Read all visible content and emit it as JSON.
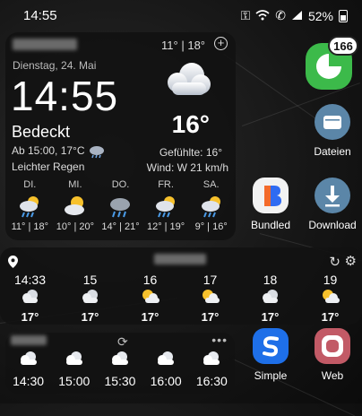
{
  "status_bar": {
    "time": "14:55",
    "battery": "52%"
  },
  "main_widget": {
    "hi_lo": "11° | 18°",
    "add_symbol": "+",
    "date": "Dienstag, 24. Mai",
    "time": "14:55",
    "condition": "Bedeckt",
    "forecast_note": "Ab 15:00, 17°C",
    "forecast_condition": "Leichter Regen",
    "temperature": "16°",
    "feels_like": "Gefühlte: 16°",
    "wind": "Wind: W 21 km/h",
    "days": [
      {
        "name": "DI.",
        "temps": "11° | 18°",
        "icon": "rain-cloud-sun"
      },
      {
        "name": "MI.",
        "temps": "10° | 20°",
        "icon": "partly-cloudy"
      },
      {
        "name": "DO.",
        "temps": "14° | 21°",
        "icon": "rain-cloud-grey"
      },
      {
        "name": "FR.",
        "temps": "12° | 19°",
        "icon": "rain-cloud-sun"
      },
      {
        "name": "SA.",
        "temps": "9° | 16°",
        "icon": "rain-cloud-sun"
      }
    ]
  },
  "hourly_widget": {
    "hours": [
      {
        "time": "14:33",
        "temp": "17°",
        "icon": "cloud"
      },
      {
        "time": "15",
        "temp": "17°",
        "icon": "cloud"
      },
      {
        "time": "16",
        "temp": "17°",
        "icon": "sun-cloud"
      },
      {
        "time": "17",
        "temp": "17°",
        "icon": "sun-cloud"
      },
      {
        "time": "18",
        "temp": "17°",
        "icon": "cloud"
      },
      {
        "time": "19",
        "temp": "17°",
        "icon": "sun-cloud"
      }
    ]
  },
  "small_widget": {
    "times": [
      "14:30",
      "15:00",
      "15:30",
      "16:00",
      "16:30"
    ]
  },
  "apps": [
    {
      "label": "",
      "badge": "166",
      "icon": "green-app-icon"
    },
    {
      "label": "Dateien",
      "icon": "folder-icon"
    },
    {
      "label": "Bundled",
      "icon": "bundled-icon"
    },
    {
      "label": "Download",
      "icon": "download-icon"
    },
    {
      "label": "Simple",
      "icon": "simple-icon"
    },
    {
      "label": "Web",
      "icon": "web-icon"
    }
  ],
  "colors": {
    "accent_green": "#3cba4a",
    "files_blue": "#5b86a8",
    "simple_blue": "#1e6fe8",
    "web_pink": "#c25a66"
  }
}
